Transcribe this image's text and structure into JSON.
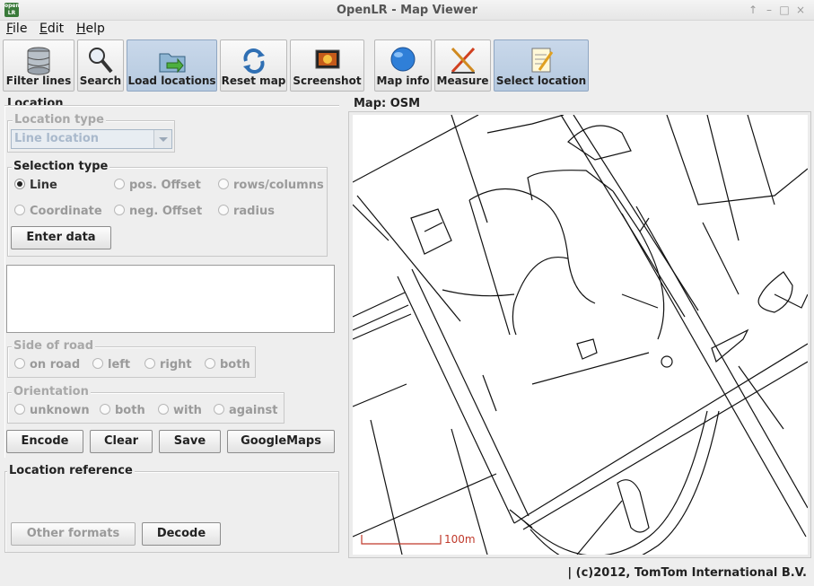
{
  "window": {
    "title": "OpenLR - Map Viewer",
    "icon_text_top": "open",
    "icon_text_bottom": "LR"
  },
  "menu": [
    {
      "label": "File",
      "mnemonic": "F",
      "rest": "ile"
    },
    {
      "label": "Edit",
      "mnemonic": "E",
      "rest": "dit"
    },
    {
      "label": "Help",
      "mnemonic": "H",
      "rest": "elp"
    }
  ],
  "toolbar": {
    "filter_lines": "Filter lines",
    "search": "Search",
    "load_locations": "Load locations",
    "reset_map": "Reset map",
    "screenshot": "Screenshot",
    "map_info": "Map info",
    "measure": "Measure",
    "select_location": "Select location"
  },
  "location": {
    "title": "Location",
    "location_type_title": "Location type",
    "location_type_value": "Line location",
    "selection_type_title": "Selection type",
    "selection_options": {
      "line": "Line",
      "pos_offset": "pos. Offset",
      "rows_columns": "rows/columns",
      "coordinate": "Coordinate",
      "neg_offset": "neg. Offset",
      "radius": "radius"
    },
    "selected": "Line",
    "enter_data": "Enter data",
    "side_of_road_title": "Side of road",
    "side_options": {
      "on_road": "on road",
      "left": "left",
      "right": "right",
      "both": "both"
    },
    "orientation_title": "Orientation",
    "orientation_options": {
      "unknown": "unknown",
      "both": "both",
      "with": "with",
      "against": "against"
    },
    "encode": "Encode",
    "clear": "Clear",
    "save": "Save",
    "googlemaps": "GoogleMaps"
  },
  "location_reference": {
    "title": "Location reference",
    "other_formats": "Other formats",
    "decode": "Decode"
  },
  "map": {
    "title": "Map: OSM",
    "scale_label": "100m"
  },
  "status_bar": {
    "text": "| (c)2012, TomTom International B.V."
  },
  "colors": {
    "active_tool": "#b5c9df",
    "scale_red": "#c0392b",
    "roads": "#111111"
  }
}
